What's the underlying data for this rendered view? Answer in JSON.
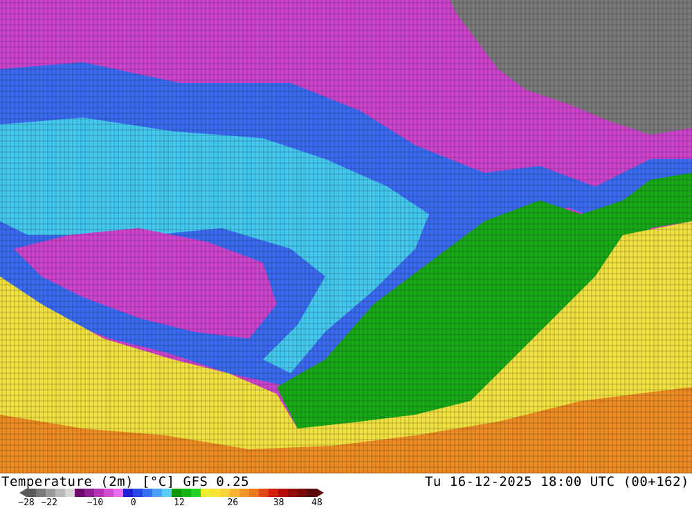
{
  "map": {
    "title": "Temperature (2m) [°C] GFS 0.25",
    "valid_time": "Tu 16-12-2025 18:00 UTC (00+162)"
  },
  "colorbar": {
    "min": -28,
    "max": 48,
    "colors": [
      "#5a5a5a",
      "#7a7a7a",
      "#9a9a9a",
      "#bababa",
      "#d6d6d6",
      "#6a0a6a",
      "#8e1e8e",
      "#b432b4",
      "#d24ad2",
      "#ee6aee",
      "#1e1ed2",
      "#2a46e6",
      "#3672f2",
      "#4aa0fa",
      "#5acefa",
      "#0a960a",
      "#14b414",
      "#26d226",
      "#f0f032",
      "#f6e63a",
      "#f8d23a",
      "#f8b432",
      "#f29628",
      "#ec7a1e",
      "#e04a14",
      "#d21e0a",
      "#b40a0a",
      "#960a0a",
      "#780a0a",
      "#5a0a0a"
    ],
    "tick_labels": [
      "-28",
      "-22",
      "-10",
      "0",
      "12",
      "26",
      "38",
      "48"
    ]
  },
  "regions": [
    {
      "name": "cold-north-magenta",
      "color": "#cc44cc"
    },
    {
      "name": "very-cold-gray",
      "color": "#7a7a7a"
    },
    {
      "name": "freezing-blue",
      "color": "#3a6af0"
    },
    {
      "name": "cool-cyan",
      "color": "#44c8f0"
    },
    {
      "name": "mild-green",
      "color": "#18a818"
    },
    {
      "name": "warm-yellow",
      "color": "#f0e040"
    },
    {
      "name": "hot-orange",
      "color": "#ec8a24"
    }
  ]
}
